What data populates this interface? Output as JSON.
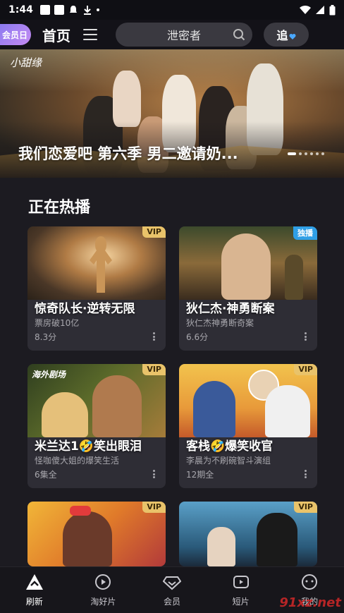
{
  "status_bar": {
    "time": "1:44"
  },
  "top_bar": {
    "vip_day": "会员日",
    "title": "首页",
    "search_placeholder": "泄密者",
    "follow_label": "追"
  },
  "banner": {
    "brand": "小甜缘",
    "title": "我们恋爱吧 第六季 男二邀请奶..."
  },
  "section": {
    "title": "正在热播"
  },
  "cards": [
    {
      "title": "惊奇队长·逆转无限",
      "subtitle": "票房破10亿",
      "meta": "8.3分",
      "badge": "VIP"
    },
    {
      "title": "狄仁杰·神勇断案",
      "subtitle": "狄仁杰神勇断奇案",
      "meta": "6.6分",
      "badge": "独播"
    },
    {
      "title": "米兰达1🤣笑出眼泪",
      "subtitle": "怪咖傻大姐的爆笑生活",
      "meta": "6集全",
      "badge": "VIP",
      "tag": "海外剧场"
    },
    {
      "title": "客栈🤣爆笑收官",
      "subtitle": "李晨为不刷碗智斗演组",
      "meta": "12期全",
      "badge": "VIP"
    },
    {
      "badge": "VIP"
    },
    {
      "badge": "VIP"
    }
  ],
  "bottom_nav": [
    {
      "label": "刷新",
      "icon": "refresh-triangle-icon"
    },
    {
      "label": "淘好片",
      "icon": "play-circle-icon"
    },
    {
      "label": "会员",
      "icon": "diamond-icon"
    },
    {
      "label": "短片",
      "icon": "short-video-icon"
    },
    {
      "label": "我的",
      "icon": "profile-icon"
    }
  ],
  "watermark": "91xz.net"
}
